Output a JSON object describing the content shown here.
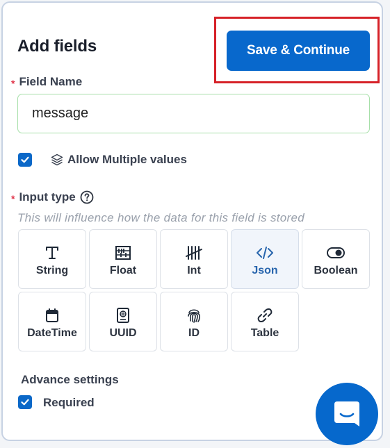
{
  "header": {
    "title": "Add fields",
    "save_label": "Save & Continue"
  },
  "field_name": {
    "label": "Field Name",
    "required_mark": "*",
    "value": "message"
  },
  "allow_multiple": {
    "label": "Allow Multiple values",
    "checked": true
  },
  "input_type": {
    "label": "Input type",
    "required_mark": "*",
    "hint": "This will influence how the data for this field is stored",
    "selected": "Json",
    "types": [
      {
        "label": "String",
        "icon": "text-icon"
      },
      {
        "label": "Float",
        "icon": "abacus-icon"
      },
      {
        "label": "Int",
        "icon": "tally-icon"
      },
      {
        "label": "Json",
        "icon": "code-icon"
      },
      {
        "label": "Boolean",
        "icon": "toggle-icon"
      },
      {
        "label": "DateTime",
        "icon": "calendar-icon"
      },
      {
        "label": "UUID",
        "icon": "passport-icon"
      },
      {
        "label": "ID",
        "icon": "fingerprint-icon"
      },
      {
        "label": "Table",
        "icon": "link-icon"
      }
    ]
  },
  "advanced": {
    "label": "Advance settings",
    "required_label": "Required",
    "required_checked": true
  },
  "colors": {
    "primary": "#0868cc",
    "highlight": "#d62128",
    "input_border": "#a6dfa8",
    "required_star": "#e0344a"
  }
}
